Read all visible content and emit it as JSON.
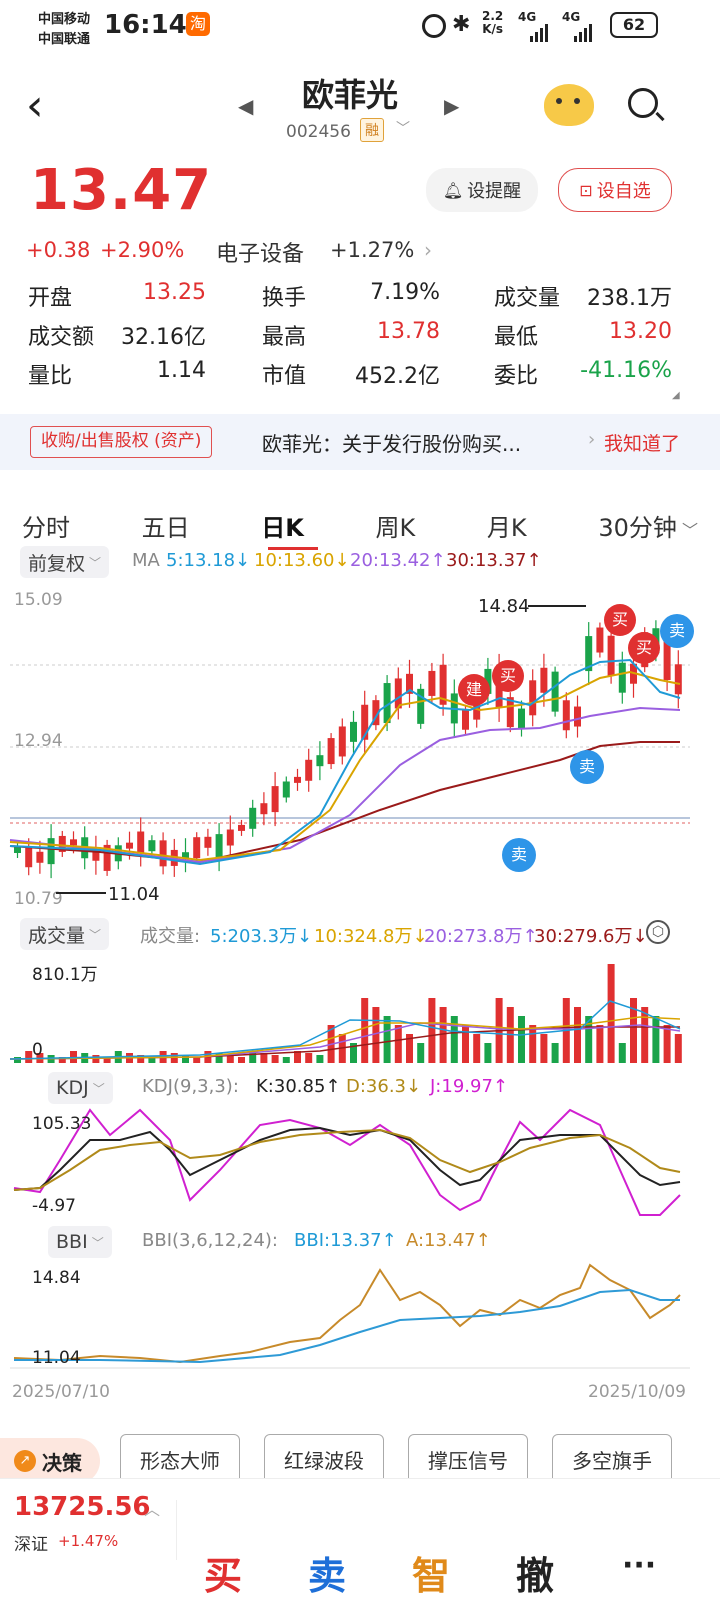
{
  "status": {
    "carrier1": "中国移动",
    "carrier2": "中国联通",
    "time": "16:14",
    "net_speed_top": "2.2",
    "net_speed_bottom": "K/s",
    "sig1": "4G",
    "sig2": "4G",
    "battery": "62"
  },
  "header": {
    "stock_name": "欧菲光",
    "stock_code": "002456",
    "margin_tag": "融"
  },
  "quote": {
    "price": "13.47",
    "change": "+0.38",
    "change_pct": "+2.90%",
    "sector": "电子设备",
    "sector_pct": "+1.27%",
    "remind_label": "设提醒",
    "watch_label": "设自选"
  },
  "stats": [
    {
      "label": "开盘",
      "value": "13.25",
      "color": "red"
    },
    {
      "label": "换手",
      "value": "7.19%",
      "color": "black"
    },
    {
      "label": "成交量",
      "value": "238.1万",
      "color": "black"
    },
    {
      "label": "成交额",
      "value": "32.16亿",
      "color": "black"
    },
    {
      "label": "最高",
      "value": "13.78",
      "color": "red"
    },
    {
      "label": "最低",
      "value": "13.20",
      "color": "red"
    },
    {
      "label": "量比",
      "value": "1.14",
      "color": "black"
    },
    {
      "label": "市值",
      "value": "452.2亿",
      "color": "black"
    },
    {
      "label": "委比",
      "value": "-41.16%",
      "color": "green"
    }
  ],
  "notice": {
    "tag": "收购/出售股权 (资产)",
    "text": "欧菲光：关于发行股份购买...",
    "action": "我知道了"
  },
  "tabs": [
    "分时",
    "五日",
    "日K",
    "周K",
    "月K",
    "30分钟"
  ],
  "ma_bar": {
    "adjust": "前复权",
    "prefix": "MA",
    "ma5": "5:13.18",
    "ma10": "10:13.60",
    "ma20": "20:13.42",
    "ma30": "30:13.37",
    "arrow_down": "↓",
    "arrow_up": "↑"
  },
  "kchart": {
    "y_top": "15.09",
    "y_mid": "12.94",
    "y_bot": "10.79",
    "high_label": "14.84",
    "low_label": "11.04",
    "signals": {
      "jian": "建",
      "mai": "买",
      "mai_mai": "买",
      "sell": "卖"
    }
  },
  "vol_bar": {
    "selector": "成交量",
    "prefix": "成交量:",
    "v5": "5:203.3万",
    "v10": "10:324.8万",
    "v20": "20:273.8万",
    "v30": "30:279.6万",
    "y_top": "810.1万",
    "y_bot": "0"
  },
  "kdj_bar": {
    "selector": "KDJ",
    "params": "KDJ(9,3,3):",
    "k": "K:30.85",
    "d": "D:36.3",
    "j": "J:19.97",
    "y_top": "105.33",
    "y_bot": "-4.97"
  },
  "bbi_bar": {
    "selector": "BBI",
    "params": "BBI(3,6,12,24):",
    "bbi": "BBI:13.37",
    "a": "A:13.47",
    "y_top": "14.84",
    "y_bot": "11.04",
    "date_start": "2025/07/10",
    "date_end": "2025/10/09"
  },
  "tools": {
    "decision": "决策",
    "items": [
      "形态大师",
      "红绿波段",
      "撑压信号",
      "多空旗手"
    ]
  },
  "bottom": {
    "index_value": "13725.56",
    "index_name": "深证",
    "index_pct": "+1.47%",
    "buy": "买",
    "sell": "卖",
    "smart": "智",
    "cancel": "撤",
    "more": "···"
  },
  "chart_data": {
    "type": "candlestick",
    "title": "欧菲光 日K",
    "ylim": [
      10.79,
      15.09
    ],
    "high": 14.84,
    "low": 11.04,
    "last_close": 13.47,
    "x_range": [
      "2025/07/10",
      "2025/10/09"
    ],
    "indicators": {
      "MA5": 13.18,
      "MA10": 13.6,
      "MA20": 13.42,
      "MA30": 13.37,
      "VOL_MA5": "203.3万",
      "VOL_MA10": "324.8万",
      "VOL_MA20": "273.8万",
      "VOL_MA30": "279.6万",
      "K": 30.85,
      "D": 36.3,
      "J": 19.97,
      "BBI": 13.37,
      "A": 13.47
    }
  }
}
